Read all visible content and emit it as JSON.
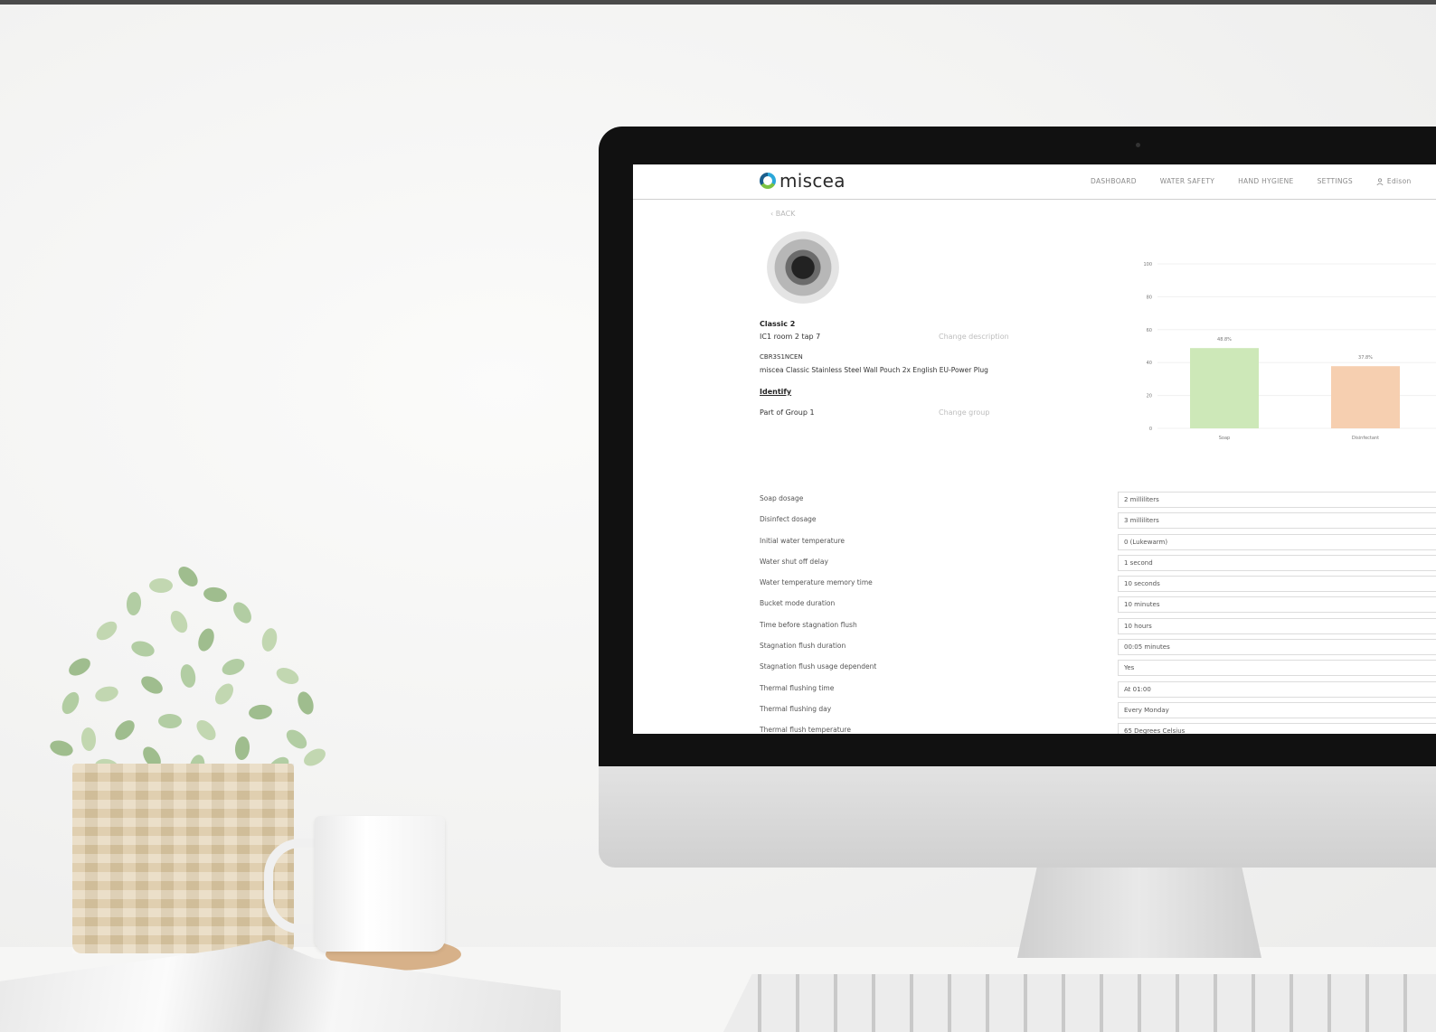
{
  "app": {
    "logo_text": "miscea",
    "brand_colors": {
      "logo_blue": "#2aa7d9",
      "logo_green": "#7bc242",
      "logo_navy": "#1b5e8c"
    }
  },
  "nav": {
    "items": [
      "DASHBOARD",
      "WATER SAFETY",
      "HAND HYGIENE",
      "SETTINGS"
    ],
    "user_label": "Edison"
  },
  "back_label": "BACK",
  "device": {
    "title": "Classic 2",
    "room": "IC1 room 2 tap 7",
    "change_description_label": "Change description",
    "code": "CBR3S1NCEN",
    "product": "miscea Classic Stainless Steel Wall Pouch 2x English EU-Power Plug",
    "identify_label": "Identify",
    "group": "Part of Group 1",
    "change_group_label": "Change group"
  },
  "chart_data": {
    "type": "bar",
    "categories": [
      "Soap",
      "Disinfectant"
    ],
    "values": [
      48.8,
      37.8
    ],
    "value_labels": [
      "48.8%",
      "37.8%"
    ],
    "colors": [
      "#cde8b8",
      "#f6cfb0"
    ],
    "ylim": [
      0,
      100
    ],
    "yticks": [
      0,
      20,
      40,
      60,
      80,
      100
    ],
    "grid": true
  },
  "settings": [
    {
      "label": "Soap dosage",
      "value": "2 milliliters"
    },
    {
      "label": "Disinfect dosage",
      "value": "3 milliliters"
    },
    {
      "label": "Initial water temperature",
      "value": "0 (Lukewarm)"
    },
    {
      "label": "Water shut off delay",
      "value": "1 second"
    },
    {
      "label": "Water temperature memory time",
      "value": "10 seconds"
    },
    {
      "label": "Bucket mode duration",
      "value": "10 minutes"
    },
    {
      "label": "Time before stagnation flush",
      "value": "10 hours"
    },
    {
      "label": "Stagnation flush duration",
      "value": "00:05 minutes"
    },
    {
      "label": "Stagnation flush usage dependent",
      "value": "Yes"
    },
    {
      "label": "Thermal flushing time",
      "value": "At 01:00"
    },
    {
      "label": "Thermal flushing day",
      "value": "Every Monday"
    },
    {
      "label": "Thermal flush temperature",
      "value": "65 Degrees Celsius"
    }
  ]
}
